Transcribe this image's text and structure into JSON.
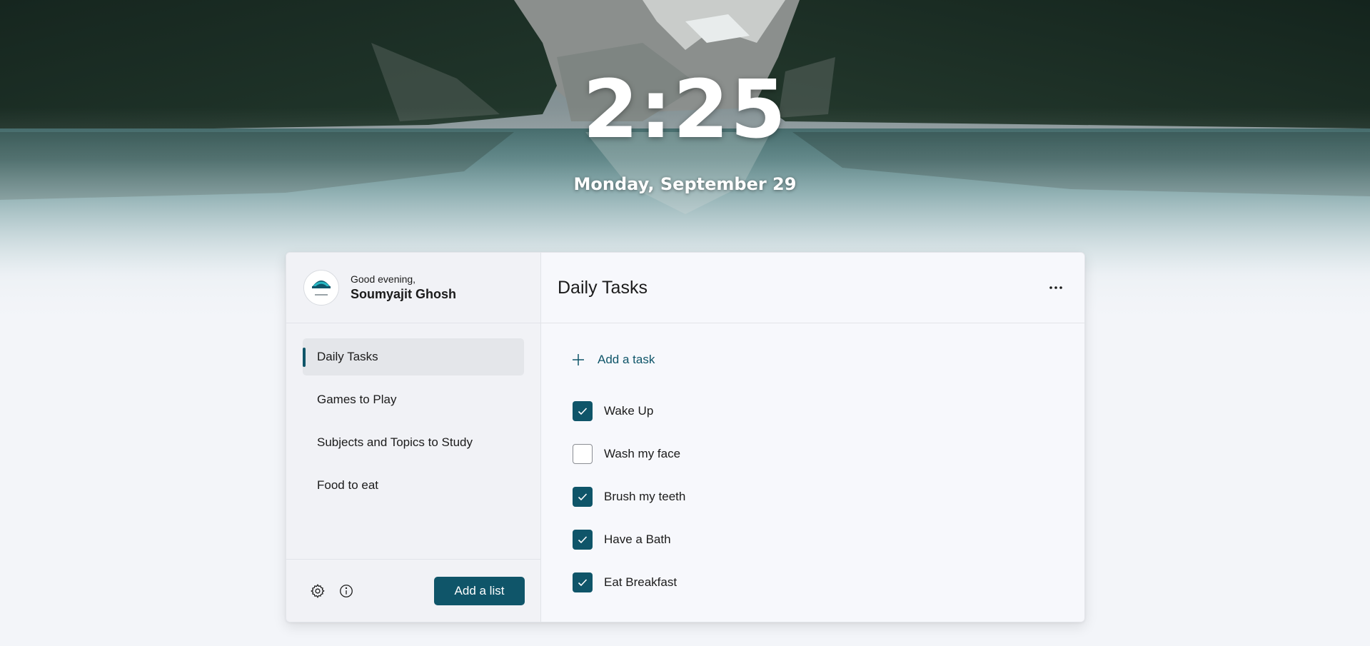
{
  "clock": {
    "time": "2:25",
    "date": "Monday, September 29"
  },
  "profile": {
    "greeting": "Good evening,",
    "name": "Soumyajit Ghosh"
  },
  "sidebar": {
    "lists": [
      {
        "label": "Daily Tasks",
        "active": true
      },
      {
        "label": "Games to Play",
        "active": false
      },
      {
        "label": "Subjects and Topics to Study",
        "active": false
      },
      {
        "label": "Food to eat",
        "active": false
      }
    ],
    "footer": {
      "settings_icon": "gear-icon",
      "info_icon": "info-icon",
      "add_list_label": "Add a list"
    }
  },
  "pane": {
    "title": "Daily Tasks",
    "more_icon": "more-horizontal-icon",
    "add_task_label": "Add a task",
    "tasks": [
      {
        "label": "Wake Up",
        "checked": true
      },
      {
        "label": "Wash my face",
        "checked": false
      },
      {
        "label": "Brush my teeth",
        "checked": true
      },
      {
        "label": "Have a Bath",
        "checked": true
      },
      {
        "label": "Eat Breakfast",
        "checked": true
      }
    ]
  },
  "colors": {
    "accent": "#0f5569",
    "background": "#f3f5f9",
    "card": "#f7f8fc",
    "sidebar": "#f1f2f6"
  }
}
